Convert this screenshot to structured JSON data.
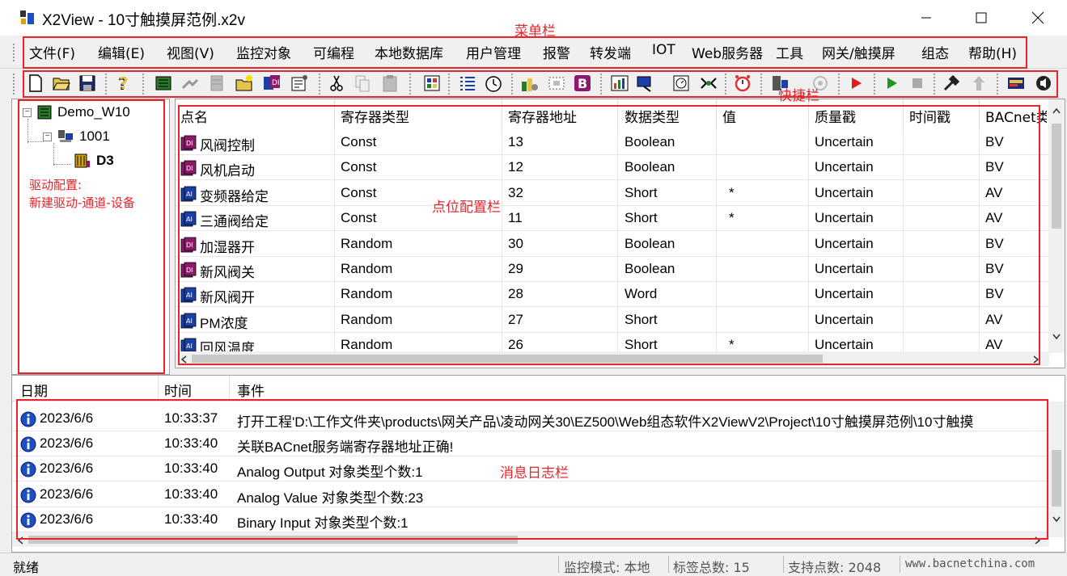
{
  "window": {
    "title": "X2View - 10寸触摸屏范例.x2v"
  },
  "menu": {
    "items": [
      "文件(F)",
      "编辑(E)",
      "视图(V)",
      "监控对象",
      "可编程",
      "本地数据库",
      "用户管理",
      "报警",
      "转发端",
      "IOT",
      "Web服务器",
      "工具",
      "网关/触摸屏",
      "组态",
      "帮助(H)"
    ]
  },
  "toolbar": {
    "icons": [
      "new-file-icon",
      "open-folder-icon",
      "save-icon",
      "help-icon",
      "device-icon",
      "connect-icon",
      "table-icon",
      "add-device-icon",
      "data-point-icon",
      "properties-icon",
      "cut-icon",
      "copy-icon",
      "paste-icon",
      "palette-icon",
      "list-icon",
      "timer-icon",
      "tools-icon",
      "grid-icon",
      "b-icon",
      "chart-icon",
      "monitor-icon",
      "calendar-icon",
      "network-icon",
      "alarm-clock-icon",
      "server-icon",
      "camera-icon",
      "play-red-icon",
      "play-green-icon",
      "stop-icon",
      "hammer-icon",
      "upload-icon",
      "display-icon",
      "speaker-icon"
    ]
  },
  "tree": {
    "root": "Demo_W10",
    "channel": "1001",
    "device": "D3"
  },
  "grid": {
    "columns": [
      "点名",
      "寄存器类型",
      "寄存器地址",
      "数据类型",
      "值",
      "质量戳",
      "时间戳",
      "BACnet类"
    ],
    "rows": [
      {
        "icon": "DI",
        "name": "风阀控制",
        "reg_type": "Const",
        "addr": "13",
        "dtype": "Boolean",
        "value": "",
        "quality": "Uncertain",
        "time": "",
        "bacnet": "BV"
      },
      {
        "icon": "DI",
        "name": "风机启动",
        "reg_type": "Const",
        "addr": "12",
        "dtype": "Boolean",
        "value": "",
        "quality": "Uncertain",
        "time": "",
        "bacnet": "BV"
      },
      {
        "icon": "AI",
        "name": "变频器给定",
        "reg_type": "Const",
        "addr": "32",
        "dtype": "Short",
        "value": "*",
        "quality": "Uncertain",
        "time": "",
        "bacnet": "AV"
      },
      {
        "icon": "AI",
        "name": "三通阀给定",
        "reg_type": "Const",
        "addr": "11",
        "dtype": "Short",
        "value": "*",
        "quality": "Uncertain",
        "time": "",
        "bacnet": "AV"
      },
      {
        "icon": "DI",
        "name": "加湿器开",
        "reg_type": "Random",
        "addr": "30",
        "dtype": "Boolean",
        "value": "",
        "quality": "Uncertain",
        "time": "",
        "bacnet": "BV"
      },
      {
        "icon": "DI",
        "name": "新风阀关",
        "reg_type": "Random",
        "addr": "29",
        "dtype": "Boolean",
        "value": "",
        "quality": "Uncertain",
        "time": "",
        "bacnet": "BV"
      },
      {
        "icon": "AI",
        "name": "新风阀开",
        "reg_type": "Random",
        "addr": "28",
        "dtype": "Word",
        "value": "",
        "quality": "Uncertain",
        "time": "",
        "bacnet": "BV"
      },
      {
        "icon": "AI",
        "name": "PM浓度",
        "reg_type": "Random",
        "addr": "27",
        "dtype": "Short",
        "value": "",
        "quality": "Uncertain",
        "time": "",
        "bacnet": "AV"
      },
      {
        "icon": "AI",
        "name": "回风温度",
        "reg_type": "Random",
        "addr": "26",
        "dtype": "Short",
        "value": "*",
        "quality": "Uncertain",
        "time": "",
        "bacnet": "AV"
      }
    ]
  },
  "log": {
    "columns": [
      "日期",
      "时间",
      "事件"
    ],
    "rows": [
      {
        "date": "2023/6/6",
        "time": "10:33:37",
        "event": "打开工程'D:\\工作文件夹\\products\\网关产品\\凌动网关30\\EZ500\\Web组态软件X2ViewV2\\Project\\10寸触摸屏范例\\10寸触摸"
      },
      {
        "date": "2023/6/6",
        "time": "10:33:40",
        "event": "关联BACnet服务端寄存器地址正确!"
      },
      {
        "date": "2023/6/6",
        "time": "10:33:40",
        "event": "Analog Output 对象类型个数:1"
      },
      {
        "date": "2023/6/6",
        "time": "10:33:40",
        "event": "Analog Value 对象类型个数:23"
      },
      {
        "date": "2023/6/6",
        "time": "10:33:40",
        "event": "Binary Input 对象类型个数:1"
      }
    ]
  },
  "status": {
    "ready": "就绪",
    "mode": "监控模式: 本地",
    "tag_count": "标签总数: 15",
    "supported_points": "支持点数: 2048",
    "website": "www.bacnetchina.com"
  },
  "annotations": {
    "menu_bar": "菜单栏",
    "toolbar": "快捷栏",
    "drive_config_line1": "驱动配置:",
    "drive_config_line2": "新建驱动-通道-设备",
    "point_config": "点位配置栏",
    "log_bar": "消息日志栏"
  },
  "colors": {
    "annotation": "#e8242c",
    "di_icon": "#8b1a6b",
    "ai_icon": "#1a3fa8",
    "info_icon": "#1e4fc2"
  }
}
